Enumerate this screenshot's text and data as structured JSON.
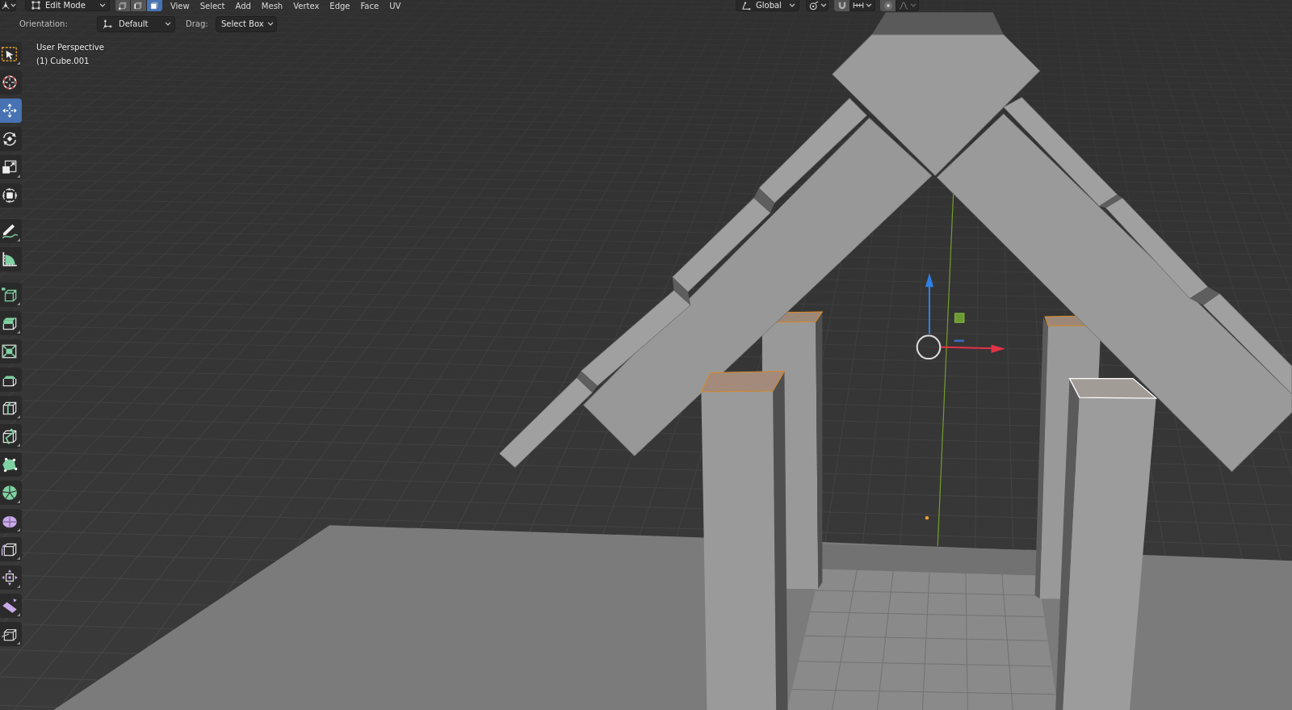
{
  "header": {
    "mode": "Edit Mode",
    "select_modes": [
      {
        "kind": "vertex",
        "selected": false
      },
      {
        "kind": "edge",
        "selected": false
      },
      {
        "kind": "face",
        "selected": true
      }
    ],
    "menus": [
      "View",
      "Select",
      "Add",
      "Mesh",
      "Vertex",
      "Edge",
      "Face",
      "UV"
    ],
    "transform_orientation": "Global",
    "snapping": {
      "on": false
    },
    "proportional_editing": {
      "on": false
    }
  },
  "tool_settings": {
    "orientation": {
      "label": "Orientation:",
      "value": "Default"
    },
    "drag": {
      "label": "Drag:",
      "value": "Select Box"
    }
  },
  "toolbar": {
    "groups": [
      {
        "tools": [
          {
            "kind": "select",
            "selected": false,
            "more_tools": true
          },
          {
            "kind": "cursor",
            "selected": false,
            "more_tools": false
          },
          {
            "kind": "move",
            "selected": true,
            "more_tools": false
          },
          {
            "kind": "rotate",
            "selected": false,
            "more_tools": false
          },
          {
            "kind": "scale",
            "selected": false,
            "more_tools": true
          },
          {
            "kind": "transform",
            "selected": false,
            "more_tools": false
          }
        ]
      },
      {
        "tools": [
          {
            "kind": "annotate",
            "selected": false,
            "more_tools": true
          },
          {
            "kind": "measure",
            "selected": false,
            "more_tools": false
          }
        ]
      },
      {
        "tools": [
          {
            "kind": "cube",
            "selected": false,
            "more_tools": true
          },
          {
            "kind": "extrude",
            "selected": false,
            "more_tools": true
          },
          {
            "kind": "inset",
            "selected": false,
            "more_tools": false
          },
          {
            "kind": "bevel",
            "selected": false,
            "more_tools": false
          },
          {
            "kind": "loopcut",
            "selected": false,
            "more_tools": true
          },
          {
            "kind": "knife",
            "selected": false,
            "more_tools": true
          },
          {
            "kind": "polybuild",
            "selected": false,
            "more_tools": false
          },
          {
            "kind": "spin",
            "selected": false,
            "more_tools": true
          },
          {
            "kind": "smooth",
            "selected": false,
            "more_tools": true
          },
          {
            "kind": "slide",
            "selected": false,
            "more_tools": true
          },
          {
            "kind": "shrink",
            "selected": false,
            "more_tools": true
          },
          {
            "kind": "shear",
            "selected": false,
            "more_tools": true
          },
          {
            "kind": "rip",
            "selected": false,
            "more_tools": true
          }
        ]
      }
    ]
  },
  "viewport": {
    "view": "User Perspective",
    "object": "(1) Cube.001"
  }
}
